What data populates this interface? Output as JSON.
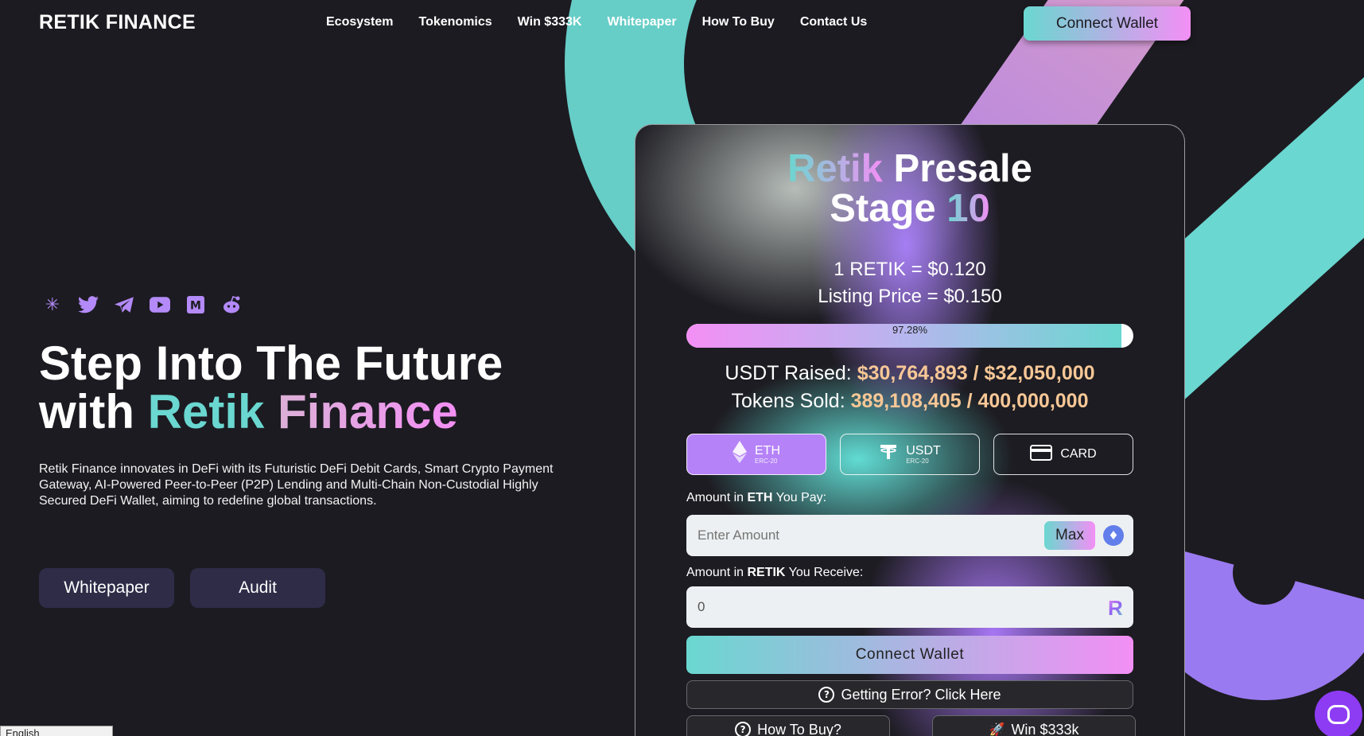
{
  "header": {
    "logo": "RETIK FINANCE",
    "nav": [
      "Ecosystem",
      "Tokenomics",
      "Win $333K",
      "Whitepaper",
      "How To Buy",
      "Contact Us"
    ],
    "connect_label": "Connect Wallet"
  },
  "hero": {
    "socials": [
      "linktree-icon",
      "twitter-icon",
      "telegram-icon",
      "youtube-icon",
      "medium-icon",
      "reddit-icon"
    ],
    "title_line1": "Step Into The Future",
    "title_with": "with ",
    "title_retik": "Retik",
    "title_finance": "Finance",
    "description": "Retik Finance innovates in DeFi with its Futuristic DeFi Debit Cards, Smart Crypto Payment Gateway, AI-Powered Peer-to-Peer (P2P) Lending and Multi-Chain Non-Custodial Highly Secured DeFi Wallet, aiming to redefine global transactions.",
    "whitepaper_label": "Whitepaper",
    "audit_label": "Audit"
  },
  "presale": {
    "title_retik": "Retik",
    "title_presale": "Presale",
    "title_stage": "Stage",
    "title_num": "10",
    "price": "1 RETIK = $0.120",
    "listing": "Listing Price = $0.150",
    "progress_percent": 97.28,
    "progress_label": "97.28%",
    "usdt_raised_label": "USDT Raised:",
    "usdt_raised_value": "$30,764,893 / $32,050,000",
    "tokens_sold_label": "Tokens Sold:",
    "tokens_sold_value": "389,108,405 / 400,000,000",
    "currencies": [
      {
        "label": "ETH",
        "sub": "ERC-20",
        "icon": "ethereum-icon"
      },
      {
        "label": "USDT",
        "sub": "ERC-20",
        "icon": "tether-icon"
      },
      {
        "label": "CARD",
        "sub": "",
        "icon": "credit-card-icon"
      }
    ],
    "pay_prefix": "Amount in ",
    "pay_token": "ETH",
    "pay_suffix": " You Pay:",
    "pay_placeholder": "Enter Amount",
    "max_label": "Max",
    "receive_prefix": "Amount in ",
    "receive_token": "RETIK",
    "receive_suffix": " You Receive:",
    "receive_value": "0",
    "connect_label": "Connect Wallet",
    "error_label": "Getting Error? Click Here",
    "howtobuy_label": "How To Buy?",
    "win_label": "Win $333k"
  },
  "footer": {
    "language": "English"
  },
  "colors": {
    "accent_teal": "#6ad7d0",
    "accent_pink": "#f38ff5",
    "accent_purple": "#b582f8",
    "value_gold": "#f8c796",
    "background": "#1c1b21"
  }
}
